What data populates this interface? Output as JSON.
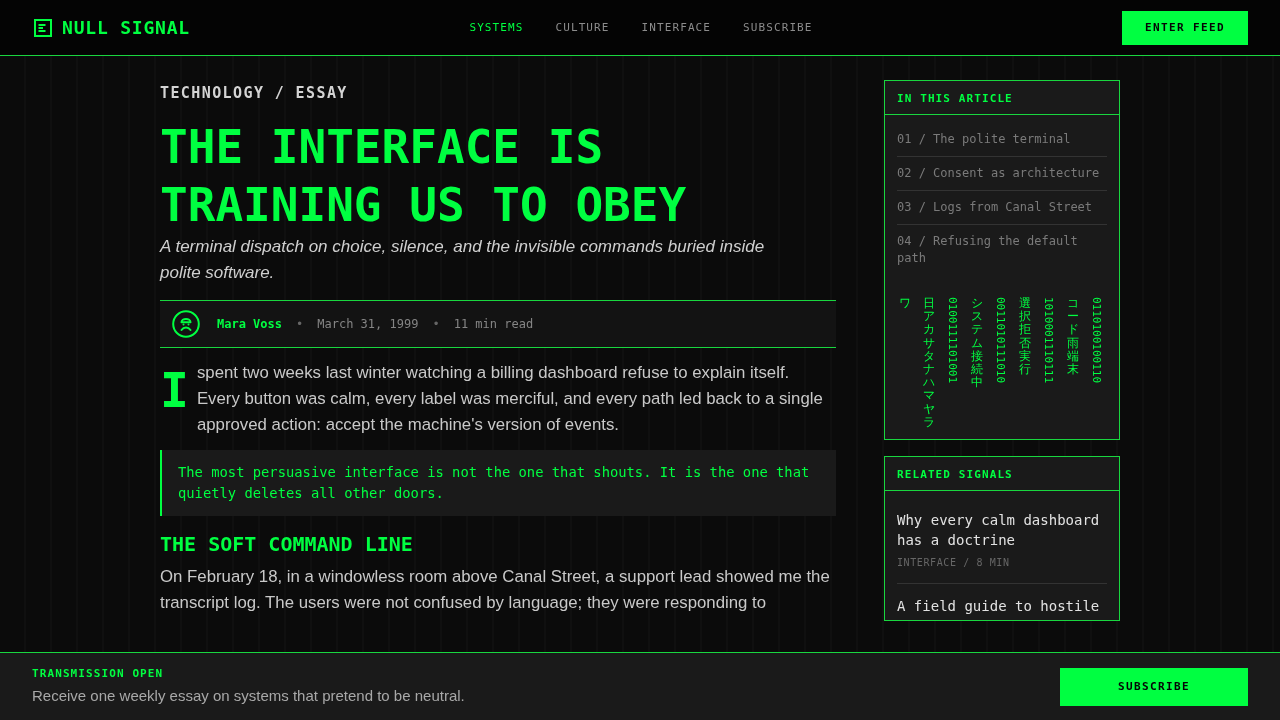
{
  "header": {
    "logo": "NULL SIGNAL",
    "nav": [
      {
        "label": "SYSTEMS",
        "selected": true
      },
      {
        "label": "CULTURE",
        "selected": false
      },
      {
        "label": "INTERFACE",
        "selected": false
      },
      {
        "label": "SUBSCRIBE",
        "selected": false
      }
    ],
    "button": "ENTER FEED"
  },
  "article": {
    "kicker": "TECHNOLOGY / ESSAY",
    "title": "THE INTERFACE IS TRAINING US TO OBEY",
    "subtitle": "A terminal dispatch on choice, silence, and the invisible commands buried inside polite software.",
    "byline": [
      {
        "kind": "author",
        "text": "Mara Voss"
      },
      {
        "kind": "separator",
        "text": "•"
      },
      {
        "kind": "info",
        "text": "March 31, 1999"
      },
      {
        "kind": "separator",
        "text": "•"
      },
      {
        "kind": "info",
        "text": "11 min read"
      }
    ],
    "body": [
      {
        "kind": "lead",
        "drop_cap": "I",
        "text": "spent two weeks last winter watching a billing dashboard refuse to explain itself. Every button was calm, every label was merciful, and every path led back to a single approved action: accept the machine's version of events."
      },
      {
        "kind": "quote",
        "text": "The most persuasive interface is not the one that shouts. It is the one that quietly deletes all other doors."
      },
      {
        "kind": "heading",
        "text": "THE SOFT COMMAND LINE"
      },
      {
        "kind": "paragraph",
        "text": "On February 18, in a windowless room above Canal Street, a support lead showed me the transcript log. The users were not confused by language; they were responding to"
      }
    ]
  },
  "sidebar": {
    "toc": {
      "title": "IN THIS ARTICLE",
      "items": [
        "01 / The polite terminal",
        "02 / Consent as architecture",
        "03 / Logs from Canal Street",
        "04 / Refusing the default path"
      ]
    },
    "code_rain": [
      {
        "kind": "kana",
        "text": "ワ"
      },
      {
        "kind": "kana",
        "text": "日アカサタナハマヤラ"
      },
      {
        "kind": "binary",
        "text": "0100111101001"
      },
      {
        "kind": "kana",
        "text": "システム接続中"
      },
      {
        "kind": "binary",
        "text": "0011010111010"
      },
      {
        "kind": "kana",
        "text": "選択拒否実行"
      },
      {
        "kind": "binary",
        "text": "1010001110111"
      },
      {
        "kind": "kana",
        "text": "コード雨端末"
      },
      {
        "kind": "binary",
        "text": "0110100100110"
      }
    ],
    "related": {
      "title": "RELATED SIGNALS",
      "items": [
        {
          "title": "Why every calm dashboard has a doctrine",
          "meta": "INTERFACE / 8 MIN"
        },
        {
          "title": "A field guide to hostile"
        }
      ]
    }
  },
  "footer_bar": {
    "label": "TRANSMISSION OPEN",
    "text": "Receive one weekly essay on systems that pretend to be neutral.",
    "button": "SUBSCRIBE"
  }
}
